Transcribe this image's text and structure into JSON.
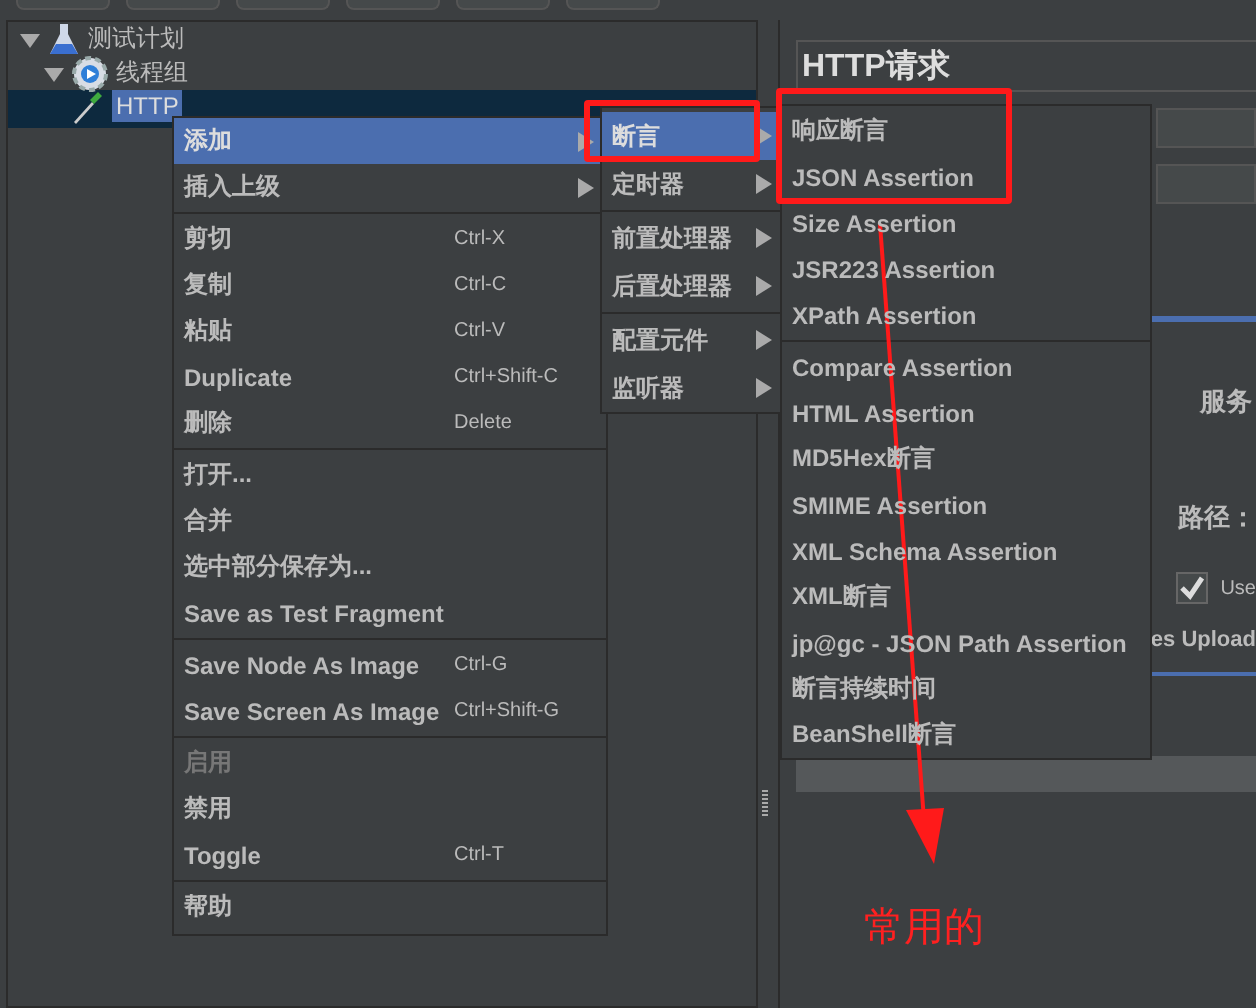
{
  "tree": [
    {
      "label": "测试计划",
      "expanded": true,
      "selected": false,
      "children": [
        {
          "label": "线程组",
          "expanded": true,
          "selected": false,
          "children": [
            {
              "label": "HTTP",
              "selected": true
            }
          ]
        }
      ]
    }
  ],
  "panel": {
    "title": "HTTP请求",
    "server_label": "服务",
    "path_label": "路径：",
    "checkbox": {
      "label": "Use",
      "checked": true
    },
    "tab": "es Upload"
  },
  "context_menu": [
    {
      "kind": "item",
      "label": "添加",
      "submenu": true,
      "selected": true,
      "disabled": false
    },
    {
      "kind": "item",
      "label": "插入上级",
      "submenu": true,
      "selected": false,
      "disabled": false
    },
    {
      "kind": "separator"
    },
    {
      "kind": "item",
      "label": "剪切",
      "shortcut": "Ctrl-X",
      "selected": false,
      "disabled": false
    },
    {
      "kind": "item",
      "label": "复制",
      "shortcut": "Ctrl-C",
      "selected": false,
      "disabled": false
    },
    {
      "kind": "item",
      "label": "粘贴",
      "shortcut": "Ctrl-V",
      "selected": false,
      "disabled": false
    },
    {
      "kind": "item",
      "label": "Duplicate",
      "shortcut": "Ctrl+Shift-C",
      "selected": false,
      "disabled": false
    },
    {
      "kind": "item",
      "label": "删除",
      "shortcut": "Delete",
      "selected": false,
      "disabled": false
    },
    {
      "kind": "separator"
    },
    {
      "kind": "item",
      "label": "打开...",
      "selected": false,
      "disabled": false
    },
    {
      "kind": "item",
      "label": "合并",
      "selected": false,
      "disabled": false
    },
    {
      "kind": "item",
      "label": "选中部分保存为...",
      "selected": false,
      "disabled": false
    },
    {
      "kind": "item",
      "label": "Save as Test Fragment",
      "selected": false,
      "disabled": false
    },
    {
      "kind": "separator"
    },
    {
      "kind": "item",
      "label": "Save Node As Image",
      "shortcut": "Ctrl-G",
      "selected": false,
      "disabled": false
    },
    {
      "kind": "item",
      "label": "Save Screen As Image",
      "shortcut": "Ctrl+Shift-G",
      "selected": false,
      "disabled": false
    },
    {
      "kind": "separator"
    },
    {
      "kind": "item",
      "label": "启用",
      "selected": false,
      "disabled": true
    },
    {
      "kind": "item",
      "label": "禁用",
      "selected": false,
      "disabled": false
    },
    {
      "kind": "item",
      "label": "Toggle",
      "shortcut": "Ctrl-T",
      "selected": false,
      "disabled": false
    },
    {
      "kind": "separator"
    },
    {
      "kind": "item",
      "label": "帮助",
      "selected": false,
      "disabled": false
    }
  ],
  "add_submenu": [
    {
      "kind": "item",
      "label": "断言",
      "submenu": true,
      "selected": true
    },
    {
      "kind": "item",
      "label": "定时器",
      "submenu": true,
      "selected": false
    },
    {
      "kind": "separator"
    },
    {
      "kind": "item",
      "label": "前置处理器",
      "submenu": true,
      "selected": false
    },
    {
      "kind": "item",
      "label": "后置处理器",
      "submenu": true,
      "selected": false
    },
    {
      "kind": "separator"
    },
    {
      "kind": "item",
      "label": "配置元件",
      "submenu": true,
      "selected": false
    },
    {
      "kind": "item",
      "label": "监听器",
      "submenu": true,
      "selected": false
    }
  ],
  "assertion_submenu": [
    {
      "kind": "item",
      "label": "响应断言",
      "selected": false
    },
    {
      "kind": "item",
      "label": "JSON Assertion",
      "selected": false
    },
    {
      "kind": "item",
      "label": "Size Assertion",
      "selected": false
    },
    {
      "kind": "item",
      "label": "JSR223 Assertion",
      "selected": false
    },
    {
      "kind": "item",
      "label": "XPath Assertion",
      "selected": false
    },
    {
      "kind": "separator"
    },
    {
      "kind": "item",
      "label": "Compare Assertion",
      "selected": false
    },
    {
      "kind": "item",
      "label": "HTML Assertion",
      "selected": false
    },
    {
      "kind": "item",
      "label": "MD5Hex断言",
      "selected": false
    },
    {
      "kind": "item",
      "label": "SMIME Assertion",
      "selected": false
    },
    {
      "kind": "item",
      "label": "XML Schema Assertion",
      "selected": false
    },
    {
      "kind": "item",
      "label": "XML断言",
      "selected": false
    },
    {
      "kind": "item",
      "label": "jp@gc - JSON Path Assertion",
      "selected": false
    },
    {
      "kind": "item",
      "label": "断言持续时间",
      "selected": false
    },
    {
      "kind": "item",
      "label": "BeanShell断言",
      "selected": false
    }
  ],
  "annotation": {
    "text": "常用的"
  }
}
